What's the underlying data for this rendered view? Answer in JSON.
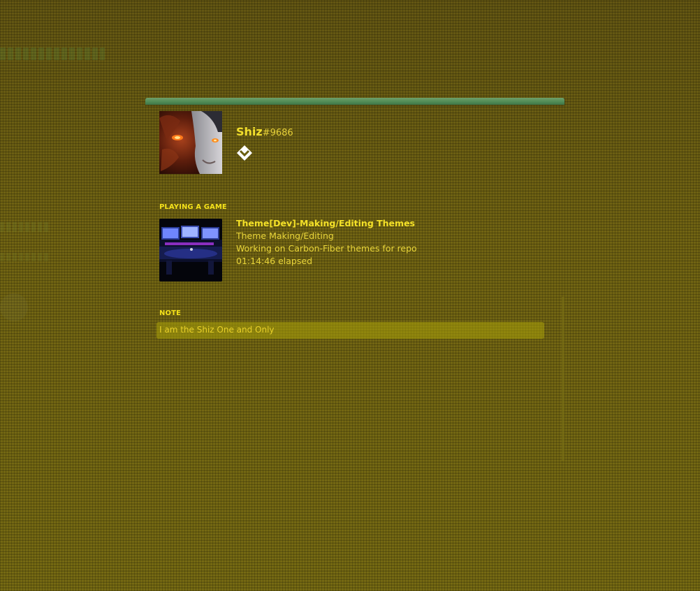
{
  "profile": {
    "username": "Shiz",
    "discriminator": "#9686",
    "badge_icon": "hypesquad-balance-icon"
  },
  "activity": {
    "header": "PLAYING A GAME",
    "name": "Theme[Dev]-Making/Editing Themes",
    "details": "Theme Making/Editing",
    "state": "Working on Carbon-Fiber themes for repo",
    "elapsed": "01:14:46 elapsed"
  },
  "note": {
    "header": "NOTE",
    "value": "I am the Shiz One and Only"
  },
  "colors": {
    "accent_text": "#f1de2c",
    "modal_top_bar": "#4f8a55",
    "background": "#645810",
    "note_field": "#aaa00a"
  }
}
